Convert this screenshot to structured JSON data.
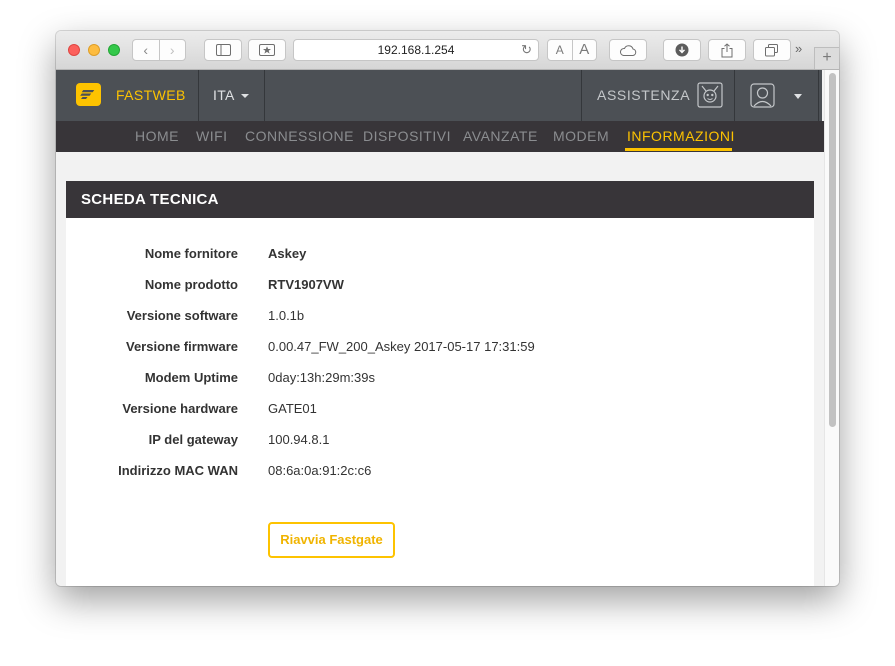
{
  "browser": {
    "url": "192.168.1.254",
    "font_small_label": "A",
    "font_large_label": "A",
    "more_label": "»",
    "new_tab_label": "+",
    "back_glyph": "‹",
    "forward_glyph": "›",
    "reload_glyph": "↻"
  },
  "header": {
    "brand": "FASTWEB",
    "language": "ITA",
    "assistance": "ASSISTENZA",
    "accent_color": "#fdc300"
  },
  "nav": {
    "items": [
      {
        "label": "HOME"
      },
      {
        "label": "WIFI"
      },
      {
        "label": "CONNESSIONE"
      },
      {
        "label": "DISPOSITIVI"
      },
      {
        "label": "AVANZATE"
      },
      {
        "label": "MODEM"
      },
      {
        "label": "INFORMAZIONI"
      }
    ],
    "active": "INFORMAZIONI"
  },
  "card": {
    "title": "SCHEDA TECNICA",
    "rows": [
      {
        "label": "Nome fornitore",
        "value": "Askey"
      },
      {
        "label": "Nome prodotto",
        "value": "RTV1907VW"
      },
      {
        "label": "Versione software",
        "value": "1.0.1b"
      },
      {
        "label": "Versione firmware",
        "value": "0.00.47_FW_200_Askey 2017-05-17 17:31:59"
      },
      {
        "label": "Modem Uptime",
        "value": "0day:13h:29m:39s"
      },
      {
        "label": "Versione hardware",
        "value": "GATE01"
      },
      {
        "label": "IP del gateway",
        "value": "100.94.8.1"
      },
      {
        "label": "Indirizzo MAC WAN",
        "value": "08:6a:0a:91:2c:c6"
      }
    ],
    "restart_button": "Riavvia Fastgate"
  }
}
